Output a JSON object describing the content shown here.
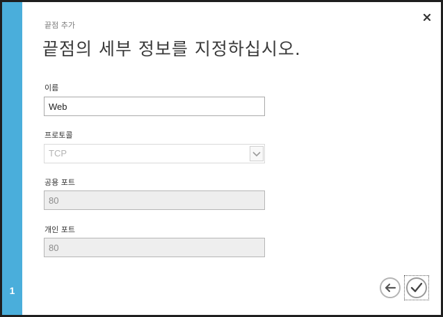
{
  "step": "1",
  "header": {
    "subtitle": "끝점 추가",
    "title": "끝점의 세부 정보를 지정하십시오."
  },
  "form": {
    "name": {
      "label": "이름",
      "value": "Web"
    },
    "protocol": {
      "label": "프로토콜",
      "value": "TCP"
    },
    "public_port": {
      "label": "공용 포트",
      "value": "80"
    },
    "private_port": {
      "label": "개인 포트",
      "value": "80"
    }
  },
  "icons": {
    "close": "close-icon",
    "back": "arrow-left-icon",
    "ok": "checkmark-icon",
    "dropdown": "chevron-down-icon"
  },
  "colors": {
    "step_bar": "#4aaedb",
    "dialog_bg": "#ffffff",
    "disabled_field": "#eeeeee"
  }
}
